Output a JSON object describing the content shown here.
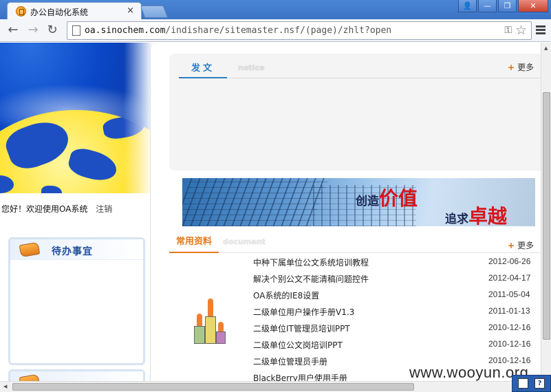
{
  "browser": {
    "tab_title": "办公自动化系统",
    "tab_close": "×",
    "url_host": "oa.sinochem.com",
    "url_path": "/indishare/sitemaster.nsf/(page)/zhlt?open",
    "window_buttons": [
      "👤",
      "—",
      "❐",
      "✕"
    ]
  },
  "nav": {
    "back": "←",
    "forward": "→",
    "reload": "↻"
  },
  "sidebar": {
    "welcome": "您好！欢迎使用OA系统",
    "logout": "注销",
    "todo_title": "待办事宜"
  },
  "notice": {
    "tab_label": "发文",
    "tab_sub": "notice",
    "more": "更多"
  },
  "promo": {
    "line1_a": "创造",
    "line1_b": "价值",
    "line2_a": "追求",
    "line2_b": "卓越"
  },
  "documents": {
    "tab_label": "常用资料",
    "tab_sub": "document",
    "more": "更多",
    "items": [
      {
        "title": "中种下属单位公文系统培训教程",
        "date": "2012-06-26"
      },
      {
        "title": "解决个别公文不能清稿问题控件",
        "date": "2012-04-17"
      },
      {
        "title": "OA系统的IE8设置",
        "date": "2011-05-04"
      },
      {
        "title": "二级单位用户操作手册V1.3",
        "date": "2011-01-13"
      },
      {
        "title": "二级单位IT管理员培训PPT",
        "date": "2010-12-16"
      },
      {
        "title": "二级单位公文岗培训PPT",
        "date": "2010-12-16"
      },
      {
        "title": "二级单位管理员手册",
        "date": "2010-12-16"
      },
      {
        "title": "BlackBerry用户使用手册",
        "date": ""
      }
    ]
  },
  "watermark": "www.wooyun.org",
  "tray": {
    "icon1": "",
    "icon2": "?"
  }
}
